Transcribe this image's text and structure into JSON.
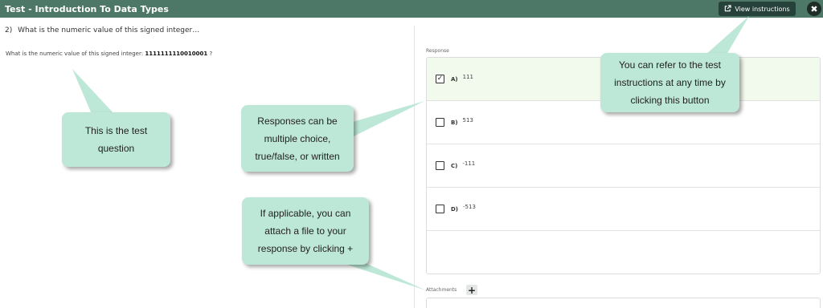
{
  "header": {
    "title": "Test - Introduction To Data Types",
    "view_instructions_label": "View instructions",
    "close_symbol": "✖"
  },
  "question": {
    "number": "2)",
    "title": "What is the numeric value of this signed integer…",
    "prompt": "What is the numeric value of this signed integer:",
    "value": "1111111110010001",
    "suffix": "?"
  },
  "response": {
    "label": "Response",
    "options": [
      {
        "letter": "A)",
        "value": "111",
        "checked": true
      },
      {
        "letter": "B)",
        "value": "513",
        "checked": false
      },
      {
        "letter": "C)",
        "value": "-111",
        "checked": false
      },
      {
        "letter": "D)",
        "value": "-513",
        "checked": false
      }
    ]
  },
  "attachments": {
    "label": "Attachments",
    "add_symbol": "+"
  },
  "callouts": {
    "test_question": "This is the test question",
    "responses": "Responses can be multiple choice, true/false, or written",
    "attach": "If applicable, you can attach a file to your response by clicking +",
    "instructions": "You can refer to the test instructions at any time by clicking this button"
  },
  "colors": {
    "header_bg": "#4d7766",
    "button_bg": "#26413a",
    "callout_bg": "#bde7d6",
    "selected_row_bg": "#f2f9ed"
  },
  "icons": {
    "view_instructions": "external-link-icon",
    "close": "close-icon",
    "checkbox_checked": "checkmark-icon",
    "attach": "plus-icon"
  }
}
